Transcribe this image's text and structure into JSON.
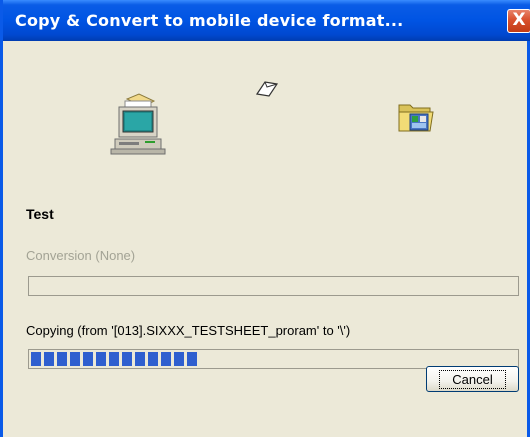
{
  "window": {
    "title": "Copy & Convert to mobile device format...",
    "close_glyph": "X"
  },
  "icons": {
    "source": "computer-icon",
    "destination": "folder-icon",
    "transfer": "flying-paper-icon"
  },
  "file_name": "Test",
  "conversion": {
    "label": "Conversion (None)",
    "progress": 0
  },
  "copying": {
    "label": "Copying (from '[013].SIXXX_TESTSHEET_proram' to '\\')",
    "progress": 0.345
  },
  "buttons": {
    "cancel": "Cancel"
  },
  "colors": {
    "titlebar": "#0054e3",
    "progress_fill": "#2f5fcf",
    "dialog_bg": "#ece9d8"
  }
}
